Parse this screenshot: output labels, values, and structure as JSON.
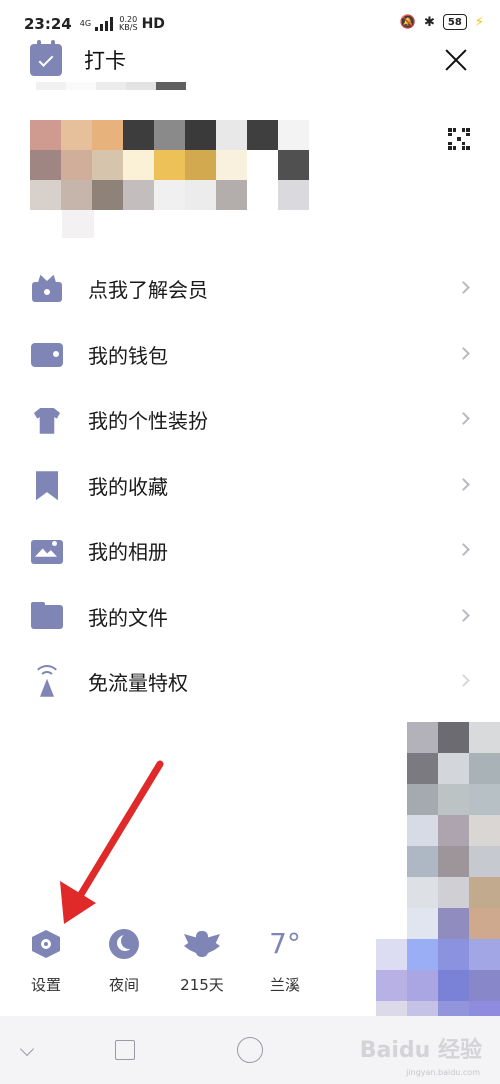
{
  "status_bar": {
    "time": "23:24",
    "network_type": "4G",
    "speed_value": "0.20",
    "speed_unit": "KB/S",
    "hd": "HD",
    "battery": "58"
  },
  "header": {
    "checkin_label": "打卡"
  },
  "menu": [
    {
      "label": "点我了解会员",
      "icon": "vip-crown-icon"
    },
    {
      "label": "我的钱包",
      "icon": "wallet-icon"
    },
    {
      "label": "我的个性装扮",
      "icon": "shirt-icon"
    },
    {
      "label": "我的收藏",
      "icon": "bookmark-icon"
    },
    {
      "label": "我的相册",
      "icon": "photo-album-icon"
    },
    {
      "label": "我的文件",
      "icon": "folder-icon"
    },
    {
      "label": "免流量特权",
      "icon": "signal-tower-icon"
    }
  ],
  "bottom_bar": {
    "settings": "设置",
    "night": "夜间",
    "days": "215天",
    "weather_temp": "7°",
    "weather_city": "兰溪"
  },
  "watermark": {
    "brand": "Baidu 经验",
    "sub": "jingyan.baidu.com"
  },
  "colors": {
    "icon_accent": "#7f86b6",
    "annotation_arrow": "#e02a2a"
  }
}
